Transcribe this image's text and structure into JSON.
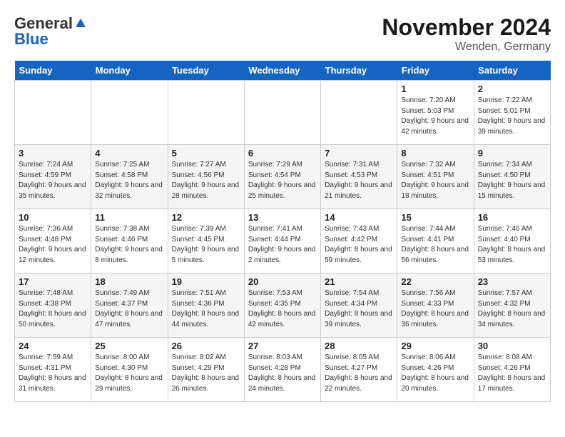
{
  "logo": {
    "text_general": "General",
    "text_blue": "Blue"
  },
  "header": {
    "month": "November 2024",
    "location": "Wenden, Germany"
  },
  "weekdays": [
    "Sunday",
    "Monday",
    "Tuesday",
    "Wednesday",
    "Thursday",
    "Friday",
    "Saturday"
  ],
  "weeks": [
    [
      {
        "day": "",
        "info": ""
      },
      {
        "day": "",
        "info": ""
      },
      {
        "day": "",
        "info": ""
      },
      {
        "day": "",
        "info": ""
      },
      {
        "day": "",
        "info": ""
      },
      {
        "day": "1",
        "info": "Sunrise: 7:20 AM\nSunset: 5:03 PM\nDaylight: 9 hours and 42 minutes."
      },
      {
        "day": "2",
        "info": "Sunrise: 7:22 AM\nSunset: 5:01 PM\nDaylight: 9 hours and 39 minutes."
      }
    ],
    [
      {
        "day": "3",
        "info": "Sunrise: 7:24 AM\nSunset: 4:59 PM\nDaylight: 9 hours and 35 minutes."
      },
      {
        "day": "4",
        "info": "Sunrise: 7:25 AM\nSunset: 4:58 PM\nDaylight: 9 hours and 32 minutes."
      },
      {
        "day": "5",
        "info": "Sunrise: 7:27 AM\nSunset: 4:56 PM\nDaylight: 9 hours and 28 minutes."
      },
      {
        "day": "6",
        "info": "Sunrise: 7:29 AM\nSunset: 4:54 PM\nDaylight: 9 hours and 25 minutes."
      },
      {
        "day": "7",
        "info": "Sunrise: 7:31 AM\nSunset: 4:53 PM\nDaylight: 9 hours and 21 minutes."
      },
      {
        "day": "8",
        "info": "Sunrise: 7:32 AM\nSunset: 4:51 PM\nDaylight: 9 hours and 18 minutes."
      },
      {
        "day": "9",
        "info": "Sunrise: 7:34 AM\nSunset: 4:50 PM\nDaylight: 9 hours and 15 minutes."
      }
    ],
    [
      {
        "day": "10",
        "info": "Sunrise: 7:36 AM\nSunset: 4:48 PM\nDaylight: 9 hours and 12 minutes."
      },
      {
        "day": "11",
        "info": "Sunrise: 7:38 AM\nSunset: 4:46 PM\nDaylight: 9 hours and 8 minutes."
      },
      {
        "day": "12",
        "info": "Sunrise: 7:39 AM\nSunset: 4:45 PM\nDaylight: 9 hours and 5 minutes."
      },
      {
        "day": "13",
        "info": "Sunrise: 7:41 AM\nSunset: 4:44 PM\nDaylight: 9 hours and 2 minutes."
      },
      {
        "day": "14",
        "info": "Sunrise: 7:43 AM\nSunset: 4:42 PM\nDaylight: 8 hours and 59 minutes."
      },
      {
        "day": "15",
        "info": "Sunrise: 7:44 AM\nSunset: 4:41 PM\nDaylight: 8 hours and 56 minutes."
      },
      {
        "day": "16",
        "info": "Sunrise: 7:46 AM\nSunset: 4:40 PM\nDaylight: 8 hours and 53 minutes."
      }
    ],
    [
      {
        "day": "17",
        "info": "Sunrise: 7:48 AM\nSunset: 4:38 PM\nDaylight: 8 hours and 50 minutes."
      },
      {
        "day": "18",
        "info": "Sunrise: 7:49 AM\nSunset: 4:37 PM\nDaylight: 8 hours and 47 minutes."
      },
      {
        "day": "19",
        "info": "Sunrise: 7:51 AM\nSunset: 4:36 PM\nDaylight: 8 hours and 44 minutes."
      },
      {
        "day": "20",
        "info": "Sunrise: 7:53 AM\nSunset: 4:35 PM\nDaylight: 8 hours and 42 minutes."
      },
      {
        "day": "21",
        "info": "Sunrise: 7:54 AM\nSunset: 4:34 PM\nDaylight: 8 hours and 39 minutes."
      },
      {
        "day": "22",
        "info": "Sunrise: 7:56 AM\nSunset: 4:33 PM\nDaylight: 8 hours and 36 minutes."
      },
      {
        "day": "23",
        "info": "Sunrise: 7:57 AM\nSunset: 4:32 PM\nDaylight: 8 hours and 34 minutes."
      }
    ],
    [
      {
        "day": "24",
        "info": "Sunrise: 7:59 AM\nSunset: 4:31 PM\nDaylight: 8 hours and 31 minutes."
      },
      {
        "day": "25",
        "info": "Sunrise: 8:00 AM\nSunset: 4:30 PM\nDaylight: 8 hours and 29 minutes."
      },
      {
        "day": "26",
        "info": "Sunrise: 8:02 AM\nSunset: 4:29 PM\nDaylight: 8 hours and 26 minutes."
      },
      {
        "day": "27",
        "info": "Sunrise: 8:03 AM\nSunset: 4:28 PM\nDaylight: 8 hours and 24 minutes."
      },
      {
        "day": "28",
        "info": "Sunrise: 8:05 AM\nSunset: 4:27 PM\nDaylight: 8 hours and 22 minutes."
      },
      {
        "day": "29",
        "info": "Sunrise: 8:06 AM\nSunset: 4:26 PM\nDaylight: 8 hours and 20 minutes."
      },
      {
        "day": "30",
        "info": "Sunrise: 8:08 AM\nSunset: 4:26 PM\nDaylight: 8 hours and 17 minutes."
      }
    ]
  ]
}
